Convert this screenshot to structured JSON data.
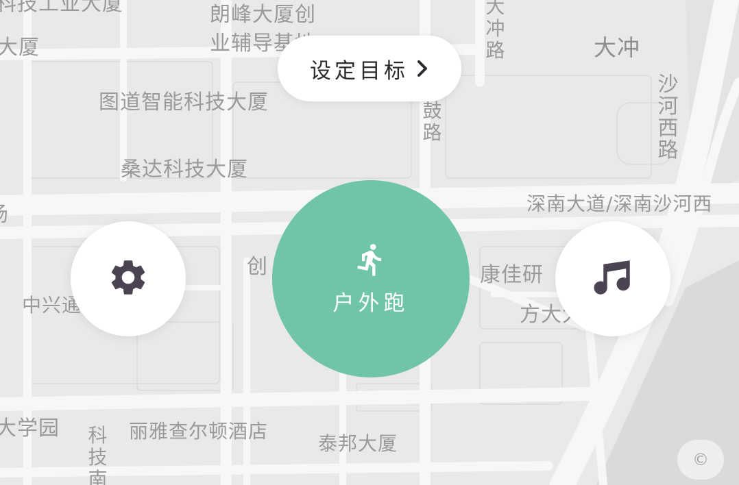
{
  "map": {
    "labels": {
      "tech_industry_bldg": "科技工业大厦",
      "dasha_left": "大厦",
      "langfeng_line1": "朗峰大厦创",
      "langfeng_line2": "业辅导基地",
      "dachong_road": "大冲路",
      "dachong": "大冲",
      "shahe_west_road": "沙河西路",
      "gu_road": "鼓路",
      "tudao": "图道智能科技大厦",
      "sangda": "桑达科技大厦",
      "shennan": "深南大道/深南沙河西",
      "chang": "场",
      "chuang": "创",
      "zhongxing": "中兴通",
      "kangjia": "康佳研",
      "fangda": "方大大",
      "daxueyuan": "大学园",
      "keji_south": "科技南",
      "liya": "丽雅查尔顿酒店",
      "taibang": "泰邦大厦"
    }
  },
  "controls": {
    "set_goal_label": "设定目标",
    "start_label": "户外跑",
    "copyright_symbol": "©"
  },
  "icons": {
    "goal_chevron": "chevron-right-icon",
    "settings": "gear-icon",
    "run": "runner-icon",
    "music": "music-note-icon"
  },
  "colors": {
    "accent_green": "#70c5a9",
    "icon_dark": "#4a4452",
    "map_bg": "#e9e9ea",
    "road": "#f7f7f8"
  }
}
